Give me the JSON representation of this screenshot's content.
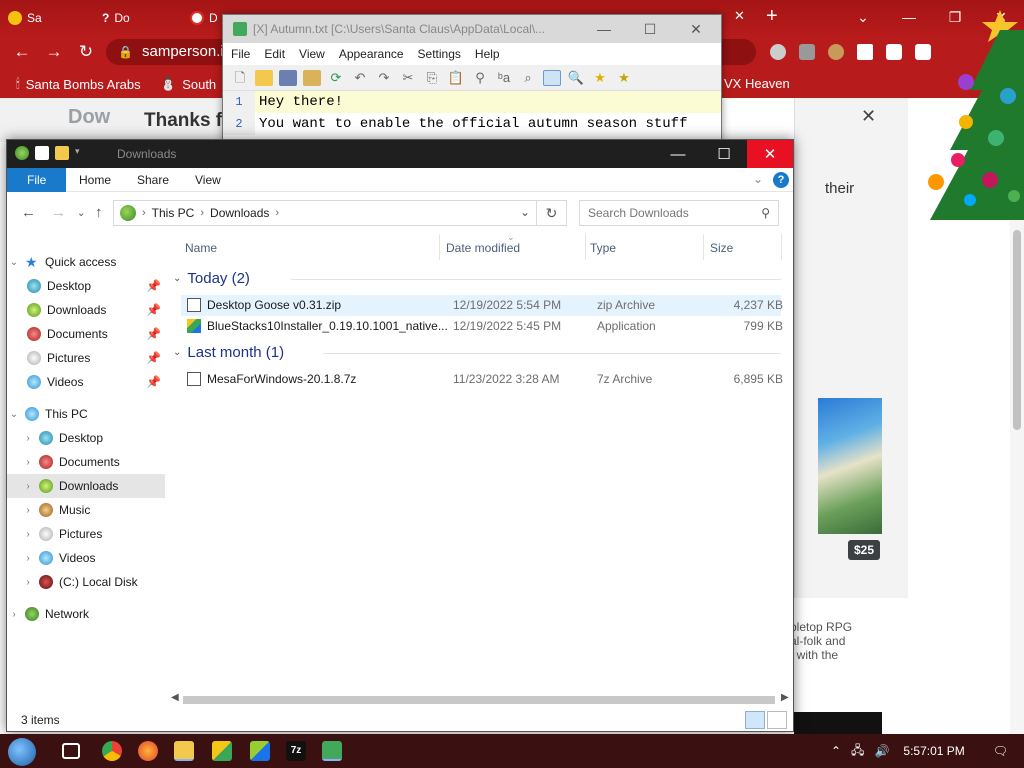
{
  "browser": {
    "tabs": [
      {
        "label": "Sa"
      },
      {
        "label": "Do"
      },
      {
        "label": "D"
      }
    ],
    "address": "samperson.it",
    "bookmarks": [
      {
        "label": "Santa Bombs Arabs"
      },
      {
        "label": "South"
      },
      {
        "label": "VX Heaven"
      }
    ],
    "page": {
      "heading_left": "Dow",
      "heading_thanks": "Thanks f",
      "dialog_text": "their",
      "price": "$25",
      "text_lines": [
        "tabletop RPG",
        "mal-folk and",
        "ge with the"
      ]
    }
  },
  "notepad": {
    "title": "[X] Autumn.txt [C:\\Users\\Santa Claus\\AppData\\Local\\...",
    "menu": [
      "File",
      "Edit",
      "View",
      "Appearance",
      "Settings",
      "Help"
    ],
    "lines": [
      {
        "num": "1",
        "text": "Hey there!"
      },
      {
        "num": "2",
        "text": "You want to enable the official autumn season stuff"
      }
    ]
  },
  "explorer": {
    "title": "Downloads",
    "ribbon_tabs": [
      "File",
      "Home",
      "Share",
      "View"
    ],
    "breadcrumb": [
      "This PC",
      "Downloads"
    ],
    "search_placeholder": "Search Downloads",
    "nav": {
      "quick_access": "Quick access",
      "quick_items": [
        "Desktop",
        "Downloads",
        "Documents",
        "Pictures",
        "Videos"
      ],
      "this_pc": "This PC",
      "pc_items": [
        "Desktop",
        "Documents",
        "Downloads",
        "Music",
        "Pictures",
        "Videos",
        "(C:) Local Disk"
      ],
      "network": "Network",
      "selected": "Downloads"
    },
    "columns": {
      "name": "Name",
      "date": "Date modified",
      "type": "Type",
      "size": "Size"
    },
    "groups": [
      {
        "label": "Today (2)",
        "files": [
          {
            "name": "Desktop Goose v0.31.zip",
            "date": "12/19/2022 5:54 PM",
            "type": "zip Archive",
            "size": "4,237 KB"
          },
          {
            "name": "BlueStacks10Installer_0.19.10.1001_native...",
            "date": "12/19/2022 5:45 PM",
            "type": "Application",
            "size": "799 KB"
          }
        ]
      },
      {
        "label": "Last month (1)",
        "files": [
          {
            "name": "MesaForWindows-20.1.8.7z",
            "date": "11/23/2022 3:28 AM",
            "type": "7z Archive",
            "size": "6,895 KB"
          }
        ]
      }
    ],
    "status": "3 items"
  },
  "taskbar": {
    "clock": "5:57:01 PM"
  },
  "colors": {
    "chrome_red": "#b71b1b",
    "ribbon_file": "#1979ca",
    "close_red": "#e81123",
    "group_blue": "#1e3287",
    "line_num_blue": "#2a63b5",
    "current_line": "#fbfbd4"
  }
}
